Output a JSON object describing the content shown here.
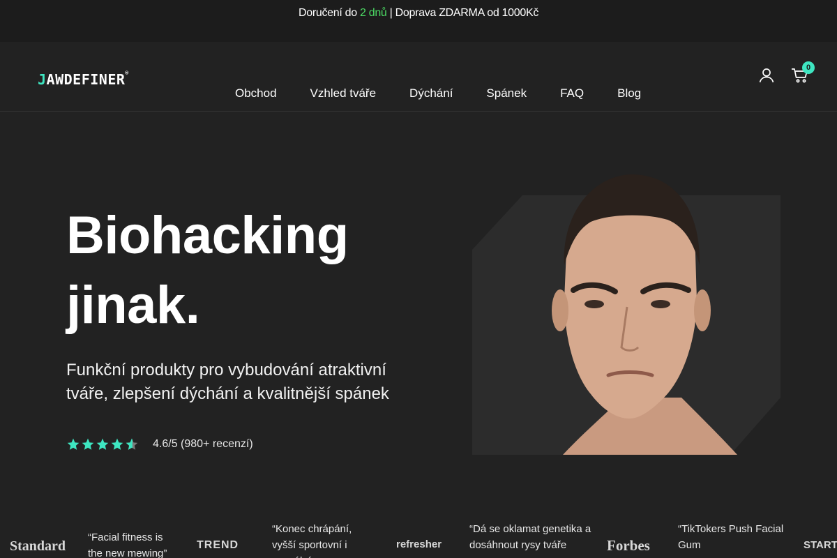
{
  "announcement": {
    "prefix": "Doručení do ",
    "highlight": "2 dnů",
    "suffix": " | Doprava ZDARMA od 1000Kč"
  },
  "header": {
    "logo_icon": "J",
    "logo_text": "AWDEFINER",
    "logo_mark": "®",
    "nav": [
      "Obchod",
      "Vzhled tváře",
      "Dýchání",
      "Spánek",
      "FAQ",
      "Blog"
    ],
    "cart_count": "0",
    "icons": [
      "user-icon",
      "cart-icon"
    ]
  },
  "hero": {
    "title_line1": "Biohacking",
    "title_line2": "jinak.",
    "subtitle": "Funkční produkty pro vybudování atraktivní tváře, zlepšení dýchání a kvalitnější spánek",
    "rating_value": 4.6,
    "rating_max": 5,
    "rating_text": "4.6/5 (980+ recenzí)",
    "star_color": "#3ee6c1"
  },
  "press": {
    "logos": [
      "Standard",
      "TREND",
      "refresher",
      "Forbes",
      "START"
    ],
    "quotes": [
      "“Facial fitness is the new mewing”",
      "“Konec chrápání, vyšší sportovní i sexuální",
      "“Dá se oklamat genetika a dosáhnout rysy tváře",
      "“TikTokers Push Facial Gum"
    ]
  },
  "colors": {
    "background": "#222222",
    "topbar": "#1c1c1c",
    "accent": "#3ee6c1",
    "highlight_green": "#4cd964"
  }
}
